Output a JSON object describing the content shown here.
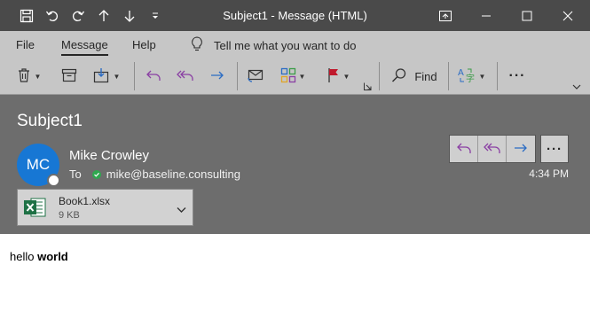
{
  "window": {
    "title": "Subject1",
    "title_sep": " - ",
    "title_suffix": "Message (HTML)"
  },
  "menu": {
    "tabs": [
      {
        "label": "File"
      },
      {
        "label": "Message",
        "active": true
      },
      {
        "label": "Help"
      }
    ],
    "tellme": "Tell me what you want to do"
  },
  "ribbon": {
    "find_label": "Find",
    "more_label": "···"
  },
  "message": {
    "subject": "Subject1",
    "avatar_initials": "MC",
    "sender": "Mike Crowley",
    "to_label": "To",
    "recipient": "mike@baseline.consulting",
    "time": "4:34 PM",
    "more_label": "···",
    "body_plain": "hello ",
    "body_bold": "world"
  },
  "attachment": {
    "name": "Book1.xlsx",
    "size": "9 KB",
    "icon": "excel-file-icon"
  },
  "colors": {
    "title_bg": "#4a4a4a",
    "ribbon_bg": "#c6c6c6",
    "header_bg": "#6d6d6d",
    "avatar": "#1777d4",
    "reply_purple": "#8a3fa3",
    "forward_blue": "#2b6cc4",
    "flag_red": "#c0192c",
    "excel_green": "#1e7145"
  }
}
